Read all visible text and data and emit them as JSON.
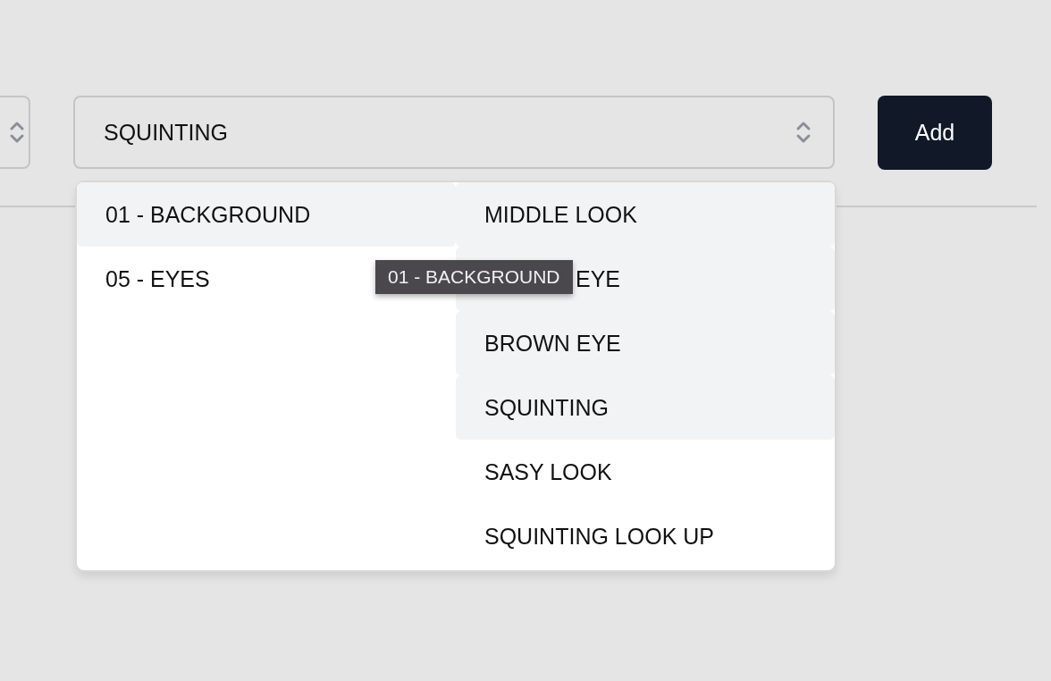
{
  "select": {
    "value": "SQUINTING"
  },
  "add_button": {
    "label": "Add"
  },
  "cascader": {
    "columns": [
      {
        "items": [
          {
            "label": "01 - BACKGROUND",
            "highlighted": true,
            "covered": false
          },
          {
            "label": "05 - EYES",
            "highlighted": false,
            "covered": false
          }
        ]
      },
      {
        "items": [
          {
            "label": "MIDDLE LOOK",
            "highlighted": true,
            "covered": false
          },
          {
            "label": "EYE",
            "highlighted": true,
            "covered": true
          },
          {
            "label": "BROWN EYE",
            "highlighted": true,
            "covered": false
          },
          {
            "label": "SQUINTING",
            "highlighted": true,
            "covered": false
          },
          {
            "label": "SASY LOOK",
            "highlighted": false,
            "covered": false
          },
          {
            "label": "SQUINTING LOOK UP",
            "highlighted": false,
            "covered": false
          }
        ]
      }
    ]
  },
  "tooltip": {
    "text": "01 - BACKGROUND"
  }
}
